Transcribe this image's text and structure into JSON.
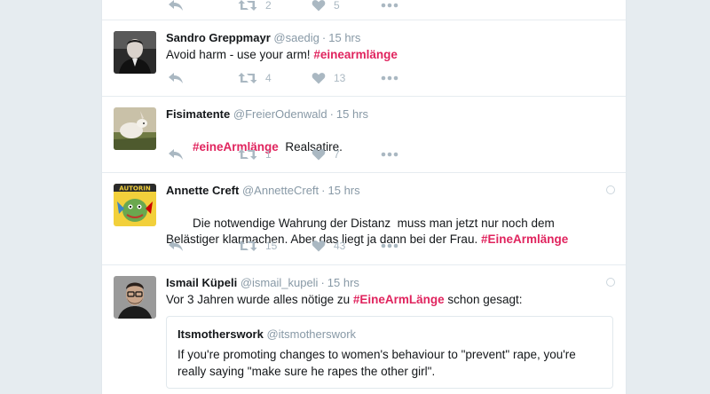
{
  "tweets": [
    {
      "name": "",
      "username": "",
      "time": "",
      "text_before": "",
      "hashtag": "",
      "text_after": "",
      "replies": "",
      "retweets": "2",
      "likes": "5"
    },
    {
      "name": "Sandro Greppmayr",
      "username": "@saedig",
      "time": "15 hrs",
      "text_before": "Avoid harm - use your arm! ",
      "hashtag": "#einearmlänge",
      "text_after": "",
      "retweets": "4",
      "likes": "13"
    },
    {
      "name": "Fisimatente",
      "username": "@FreierOdenwald",
      "time": "15 hrs",
      "text_before": "",
      "hashtag": "#eineArmlänge",
      "text_after": "  Realsatire.",
      "retweets": "1",
      "likes": "7"
    },
    {
      "name": "Annette Creft",
      "username": "@AnnetteCreft",
      "time": "15 hrs",
      "text_before": "Die notwendige Wahrung der Distanz  muss man jetzt nur noch dem Belästiger klarmachen. Aber das liegt ja dann bei der Frau. ",
      "hashtag": "#EineArmlänge",
      "text_after": "",
      "retweets": "15",
      "likes": "43"
    },
    {
      "name": "Ismail Küpeli",
      "username": "@ismail_kupeli",
      "time": "15 hrs",
      "text_before": "Vor 3 Jahren wurde alles nötige zu ",
      "hashtag": "#EineArmLänge",
      "text_after": " schon gesagt:",
      "quote": {
        "name": "Itsmotherswork",
        "username": "@itsmotherswork",
        "text": "If you're promoting changes to women's behaviour to \"prevent\" rape, you're really saying \"make sure he rapes the other girl\"."
      }
    }
  ],
  "colors": {
    "hashtag": "#e0245e",
    "muted": "#8899a6",
    "icon": "#aab8c2",
    "background": "#e6ecf0"
  },
  "icons": [
    "reply-icon",
    "retweet-icon",
    "like-icon",
    "more-icon",
    "caret-icon"
  ],
  "avatars": [
    "avatar-sandro",
    "avatar-fisimatente",
    "avatar-annette-autorin",
    "avatar-ismail"
  ]
}
